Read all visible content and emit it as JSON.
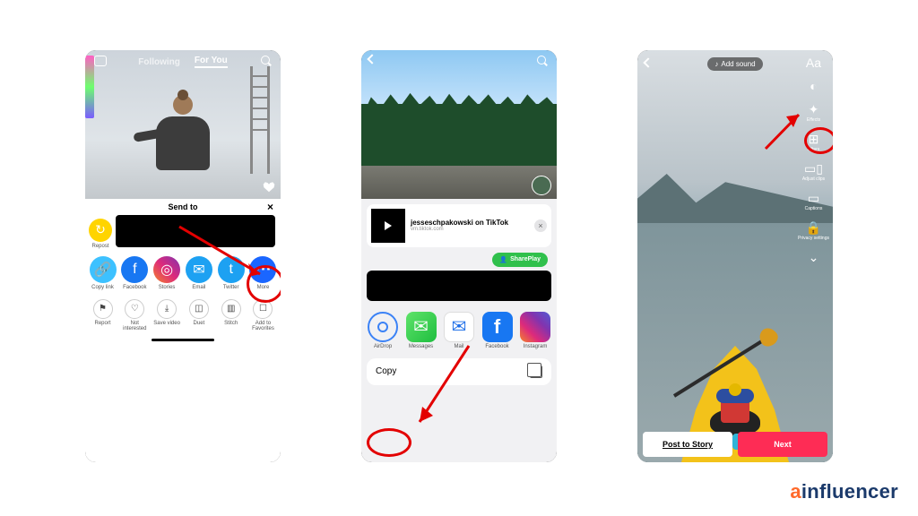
{
  "watermark": {
    "a": "a",
    "i": "influencer"
  },
  "phone1": {
    "tabs": {
      "following": "Following",
      "foryou": "For You"
    },
    "sheet_title": "Send to",
    "close": "×",
    "repost_label": "Repost",
    "share_row": [
      {
        "label": "Copy link",
        "bg": "#3dc1ff",
        "glyph": "🔗"
      },
      {
        "label": "Facebook",
        "bg": "#1877f2",
        "glyph": "f"
      },
      {
        "label": "Stories",
        "bg": "linear-gradient(45deg,#f58529,#dd2a7b,#8134af)",
        "glyph": "◎"
      },
      {
        "label": "Email",
        "bg": "#1da1f2",
        "glyph": "✉"
      },
      {
        "label": "Twitter",
        "bg": "#1da1f2",
        "glyph": "t"
      },
      {
        "label": "More",
        "bg": "#1a66ff",
        "glyph": "⋯"
      }
    ],
    "action_row": [
      {
        "label": "Report",
        "glyph": "⚑"
      },
      {
        "label": "Not interested",
        "glyph": "♡"
      },
      {
        "label": "Save video",
        "glyph": "⤓"
      },
      {
        "label": "Duet",
        "glyph": "◫"
      },
      {
        "label": "Stitch",
        "glyph": "▥"
      },
      {
        "label": "Add to Favorites",
        "glyph": "☐"
      }
    ]
  },
  "phone2": {
    "link_title": "jesseschpakowski on TikTok",
    "link_sub": "vm.tiktok.com",
    "shareplay": "SharePlay",
    "apps": [
      {
        "label": "AirDrop"
      },
      {
        "label": "Messages"
      },
      {
        "label": "Mail"
      },
      {
        "label": "Facebook"
      },
      {
        "label": "Instagram"
      }
    ],
    "copy": "Copy"
  },
  "phone3": {
    "add_sound": "Add sound",
    "tools": [
      {
        "glyph": "Aa",
        "label": ""
      },
      {
        "glyph": "◐",
        "label": ""
      },
      {
        "glyph": "✦",
        "label": "Effects"
      },
      {
        "glyph": "⊞",
        "label": "Filters"
      },
      {
        "glyph": "▭▯",
        "label": "Adjust clips"
      },
      {
        "glyph": "▭",
        "label": "Captions"
      },
      {
        "glyph": "🔒",
        "label": "Privacy settings"
      },
      {
        "glyph": "⌄",
        "label": ""
      }
    ],
    "post_story": "Post to Story",
    "next": "Next"
  }
}
